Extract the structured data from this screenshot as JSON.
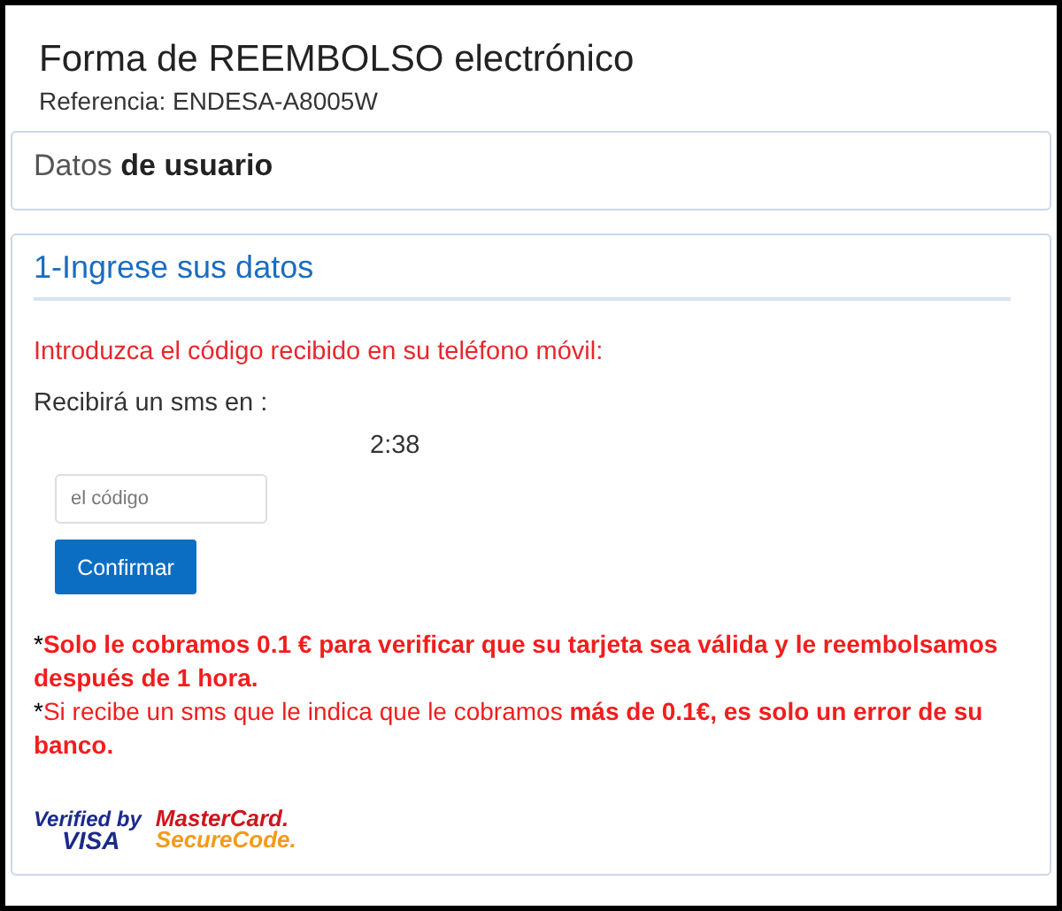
{
  "header": {
    "title": "Forma de REEMBOLSO electrónico",
    "reference": "Referencia: ENDESA-A8005W"
  },
  "user_panel": {
    "heading": "Datos **de usuario**"
  },
  "form_panel": {
    "heading": "1-Ingrese sus datos",
    "instruction": "Introduzca el código recibido en su teléfono móvil:",
    "sms_label": "Recibirá un sms en :",
    "countdown": "2:38",
    "code_field": {
      "placeholder": "el código"
    },
    "button": "Confirmar",
    "notes": [
      {
        "mark": "*",
        "text": "**Solo le cobramos 0.1 € para verificar que su tarjeta sea válida y le reembolsamos después de 1 hora.**"
      },
      {
        "mark": "*",
        "text": "Si recibe un sms que le indica que le cobramos **más de 0.1€, es solo un error de su banco.**"
      }
    ],
    "logos": [
      {
        "kind": "visa",
        "top": "Verified by",
        "bottom": "VISA"
      },
      {
        "kind": "mastercard",
        "top": "MasterCard.",
        "bottom": "SecureCode."
      }
    ]
  }
}
